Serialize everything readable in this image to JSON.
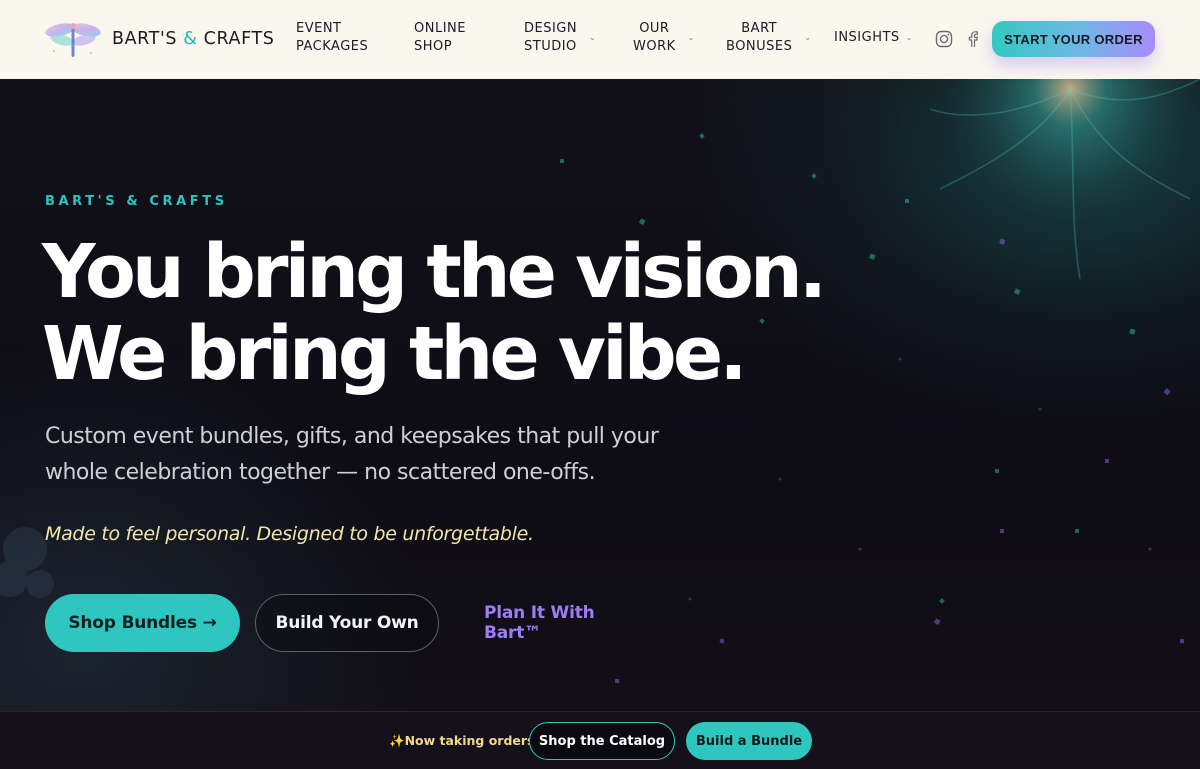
{
  "brand": {
    "name_part1": "BART'S ",
    "ampersand": "&",
    "name_part2": " CRAFTS",
    "logo_icon": "dragonfly-icon"
  },
  "nav": {
    "items": [
      {
        "label": "EVENT\nPACKAGES",
        "has_dropdown": false
      },
      {
        "label": "ONLINE\nSHOP",
        "has_dropdown": false
      },
      {
        "label": "DESIGN\nSTUDIO",
        "has_dropdown": true
      },
      {
        "label": "OUR\nWORK",
        "has_dropdown": true
      },
      {
        "label": "BART\nBONUSES",
        "has_dropdown": true
      },
      {
        "label": "INSIGHTS",
        "has_dropdown": true
      }
    ],
    "social": [
      "instagram-icon",
      "facebook-icon"
    ],
    "cta_label": "START YOUR ORDER"
  },
  "hero": {
    "eyebrow": "BART'S & CRAFTS",
    "headline_line1": "You bring the vision.",
    "headline_line2": "We bring the vibe.",
    "subcopy": "Custom event bundles, gifts, and keepsakes that pull your whole celebration together — no scattered one-offs.",
    "tagline": "Made to feel personal. Designed to be unforgettable.",
    "primary_button": "Shop Bundles →",
    "secondary_button": "Build Your Own",
    "link_button": "Plan It With Bart™"
  },
  "bottom_bar": {
    "note": "✨Now taking orders",
    "outline_button": "Shop the Catalog",
    "solid_button": "Build a Bundle"
  },
  "colors": {
    "accent_teal": "#2ec7bf",
    "accent_purple": "#9d7cf4",
    "tagline_yellow": "#f1e7a7",
    "nav_bg": "#faf7ef"
  }
}
